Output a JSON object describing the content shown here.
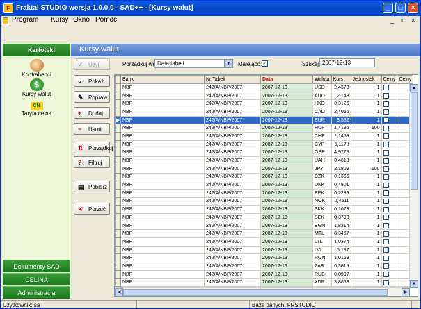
{
  "window": {
    "title": "Fraktal STUDIO   wersja 1.0.0.0 - SAD++ - [Kursy walut]"
  },
  "menu": {
    "items": [
      "Program",
      "Kursy",
      "Okno",
      "Pomoc"
    ]
  },
  "sidebar": {
    "header": "Kartoteki",
    "items": [
      {
        "label": "Kontrahenci",
        "icon": "contacts-icon"
      },
      {
        "label": "Kursy walut",
        "icon": "dollar-icon"
      },
      {
        "label": "Taryfa celna",
        "icon": "tariff-icon"
      }
    ],
    "sections": [
      "Dokumenty SAD",
      "CELINA",
      "Administracja"
    ]
  },
  "main": {
    "title": "Kursy walut",
    "buttons": [
      "Użyj",
      "Pokaż",
      "Popraw",
      "Dodaj",
      "Usuń",
      "Porządkuj",
      "Filtruj",
      "Pobierz",
      "Porzuć"
    ],
    "sort_label": "Porządkuj wg:",
    "sort_value": "Data tabeli",
    "desc_label": "Malejąco:",
    "desc_checked": true,
    "search_label": "Szukaj:",
    "search_value": "2007-12-13"
  },
  "table": {
    "columns": [
      "Bank",
      "Nr Tabeli",
      "Data",
      "Waluta",
      "Kurs",
      "Jednostek",
      "Celny",
      "Celny"
    ],
    "selected_row": 4,
    "rows": [
      [
        "NBP",
        "242/A/NBP/2007",
        "2007-12-13",
        "USD",
        "2,4373",
        "1"
      ],
      [
        "NBP",
        "242/A/NBP/2007",
        "2007-12-13",
        "AUD",
        "2,148",
        "1"
      ],
      [
        "NBP",
        "242/A/NBP/2007",
        "2007-12-13",
        "HKD",
        "0,3126",
        "1"
      ],
      [
        "NBP",
        "242/A/NBP/2007",
        "2007-12-13",
        "CAD",
        "2,4056",
        "1"
      ],
      [
        "NBP",
        "242/A/NBP/2007",
        "2007-12-13",
        "EUR",
        "3,582",
        "1"
      ],
      [
        "NBP",
        "242/A/NBP/2007",
        "2007-12-13",
        "HUF",
        "1,4195",
        "100"
      ],
      [
        "NBP",
        "242/A/NBP/2007",
        "2007-12-13",
        "CHF",
        "2,1459",
        "1"
      ],
      [
        "NBP",
        "242/A/NBP/2007",
        "2007-12-13",
        "CYP",
        "6,1178",
        "1"
      ],
      [
        "NBP",
        "242/A/NBP/2007",
        "2007-12-13",
        "GBP",
        "4,9778",
        "1"
      ],
      [
        "NBP",
        "242/A/NBP/2007",
        "2007-12-13",
        "UAH",
        "0,4813",
        "1"
      ],
      [
        "NBP",
        "242/A/NBP/2007",
        "2007-12-13",
        "JPY",
        "2,1809",
        "100"
      ],
      [
        "NBP",
        "242/A/NBP/2007",
        "2007-12-13",
        "CZK",
        "0,1365",
        "1"
      ],
      [
        "NBP",
        "242/A/NBP/2007",
        "2007-12-13",
        "DKK",
        "0,4801",
        "1"
      ],
      [
        "NBP",
        "242/A/NBP/2007",
        "2007-12-13",
        "EEK",
        "0,2289",
        "1"
      ],
      [
        "NBP",
        "242/A/NBP/2007",
        "2007-12-13",
        "NOK",
        "0,4511",
        "1"
      ],
      [
        "NBP",
        "242/A/NBP/2007",
        "2007-12-13",
        "SKK",
        "0,1079",
        "1"
      ],
      [
        "NBP",
        "242/A/NBP/2007",
        "2007-12-13",
        "SEK",
        "0,3793",
        "1"
      ],
      [
        "NBP",
        "242/A/NBP/2007",
        "2007-12-13",
        "BGN",
        "1,8314",
        "1"
      ],
      [
        "NBP",
        "242/A/NBP/2007",
        "2007-12-13",
        "MTL",
        "8,3467",
        "1"
      ],
      [
        "NBP",
        "242/A/NBP/2007",
        "2007-12-13",
        "LTL",
        "1,0374",
        "1"
      ],
      [
        "NBP",
        "242/A/NBP/2007",
        "2007-12-13",
        "LVL",
        "5,137",
        "1"
      ],
      [
        "NBP",
        "242/A/NBP/2007",
        "2007-12-13",
        "RON",
        "1,0169",
        "1"
      ],
      [
        "NBP",
        "242/A/NBP/2007",
        "2007-12-13",
        "ZAR",
        "0,3619",
        "1"
      ],
      [
        "NBP",
        "242/A/NBP/2007",
        "2007-12-13",
        "RUB",
        "0,0997",
        "1"
      ],
      [
        "NBP",
        "242/A/NBP/2007",
        "2007-12-13",
        "XDR",
        "3,8668",
        "1"
      ]
    ]
  },
  "status": {
    "user": "Użytkownik: sa",
    "db": "Baza danych: FRSTUDIO"
  }
}
